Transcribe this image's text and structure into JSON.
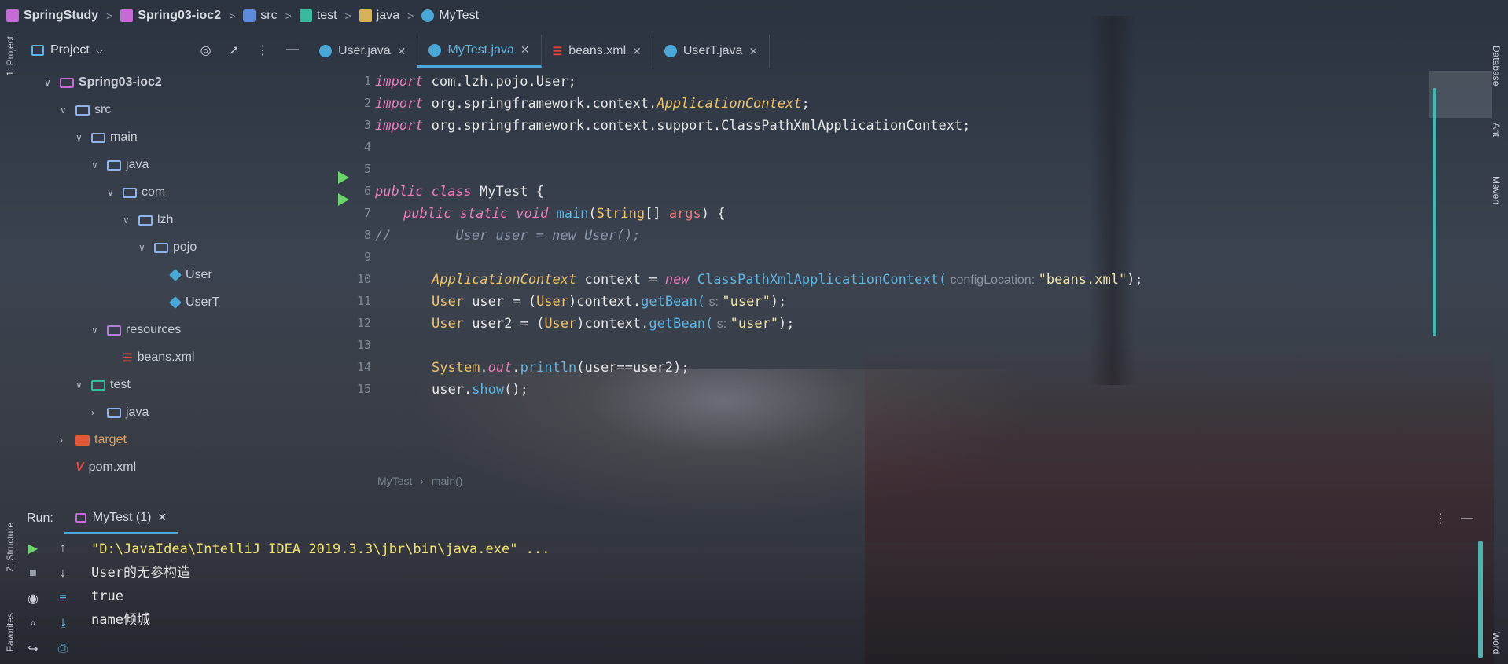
{
  "breadcrumb": {
    "project": "SpringStudy",
    "module": "Spring03-ioc2",
    "src": "src",
    "test": "test",
    "java": "java",
    "file": "MyTest"
  },
  "left_strip": {
    "project_label": "1: Project",
    "structure_label": "Z: Structure",
    "favorites_label": "Favorites"
  },
  "right_strip": {
    "database_label": "Database",
    "ant_label": "Ant",
    "maven_label": "Maven",
    "word_label": "Word"
  },
  "project_panel": {
    "title": "Project",
    "tree": [
      {
        "label": "Spring03-ioc2",
        "level": 0,
        "kind": "module",
        "expanded": true
      },
      {
        "label": "src",
        "level": 1,
        "kind": "src",
        "expanded": true
      },
      {
        "label": "main",
        "level": 2,
        "kind": "folder",
        "expanded": true
      },
      {
        "label": "java",
        "level": 3,
        "kind": "folder",
        "expanded": true
      },
      {
        "label": "com",
        "level": 4,
        "kind": "folder",
        "expanded": true
      },
      {
        "label": "lzh",
        "level": 5,
        "kind": "folder",
        "expanded": true
      },
      {
        "label": "pojo",
        "level": 6,
        "kind": "folder",
        "expanded": true
      },
      {
        "label": "User",
        "level": 7,
        "kind": "class"
      },
      {
        "label": "UserT",
        "level": 7,
        "kind": "class"
      },
      {
        "label": "resources",
        "level": 3,
        "kind": "resources",
        "expanded": true
      },
      {
        "label": "beans.xml",
        "level": 4,
        "kind": "xml"
      },
      {
        "label": "test",
        "level": 2,
        "kind": "test",
        "expanded": true
      },
      {
        "label": "java",
        "level": 3,
        "kind": "folder",
        "expanded": false
      },
      {
        "label": "target",
        "level": 1,
        "kind": "target",
        "expanded": false
      },
      {
        "label": "pom.xml",
        "level": 1,
        "kind": "maven"
      }
    ]
  },
  "tabs": [
    {
      "label": "User.java",
      "active": false
    },
    {
      "label": "MyTest.java",
      "active": true
    },
    {
      "label": "beans.xml",
      "active": false
    },
    {
      "label": "UserT.java",
      "active": false
    }
  ],
  "editor": {
    "line_numbers": [
      "1",
      "2",
      "3",
      "4",
      "5",
      "6",
      "7",
      "8",
      "9",
      "10",
      "11",
      "12",
      "13",
      "14",
      "15"
    ],
    "l1_kw": "import",
    "l1_rest": " com.lzh.pojo.User;",
    "l2_kw": "import",
    "l2_a": " org.springframework.context.",
    "l2_b": "ApplicationContext",
    "l2_c": ";",
    "l3_kw": "import",
    "l3_rest": " org.springframework.context.support.ClassPathXmlApplicationContext;",
    "l6_kw": "public class",
    "l6_rest": " MyTest {",
    "l7_kw": "public static void",
    "l7_fn": " main",
    "l7_a": "(",
    "l7_ty": "String",
    "l7_b": "[] ",
    "l7_arg": "args",
    "l7_c": ") {",
    "l8": "//        User user = new User();",
    "l10_ty": "ApplicationContext",
    "l10_a": " context = ",
    "l10_kw": "new",
    "l10_fn": " ClassPathXmlApplicationContext(",
    "l10_hint": " configLocation: ",
    "l10_st": "\"beans.xml\"",
    "l10_end": ");",
    "l11_ty": "User",
    "l11_a": " user = (",
    "l11_ty2": "User",
    "l11_b": ")context.",
    "l11_fn": "getBean(",
    "l11_hint": " s: ",
    "l11_st": "\"user\"",
    "l11_end": ");",
    "l12_ty": "User",
    "l12_a": " user2 = (",
    "l12_ty2": "User",
    "l12_b": ")context.",
    "l12_fn": "getBean(",
    "l12_hint": " s: ",
    "l12_st": "\"user\"",
    "l12_end": ");",
    "l14_ty": "System",
    "l14_a": ".",
    "l14_out": "out",
    "l14_b": ".",
    "l14_fn": "println",
    "l14_c": "(user==user2);",
    "l15_a": "user.",
    "l15_fn": "show",
    "l15_b": "();",
    "crumb_class": "MyTest",
    "crumb_method": "main()"
  },
  "run_panel": {
    "label": "Run:",
    "tab_label": "MyTest (1)",
    "output": [
      "\"D:\\JavaIdea\\IntelliJ IDEA 2019.3.3\\jbr\\bin\\java.exe\" ...",
      "User的无参构造",
      "true",
      "name倾城"
    ]
  }
}
